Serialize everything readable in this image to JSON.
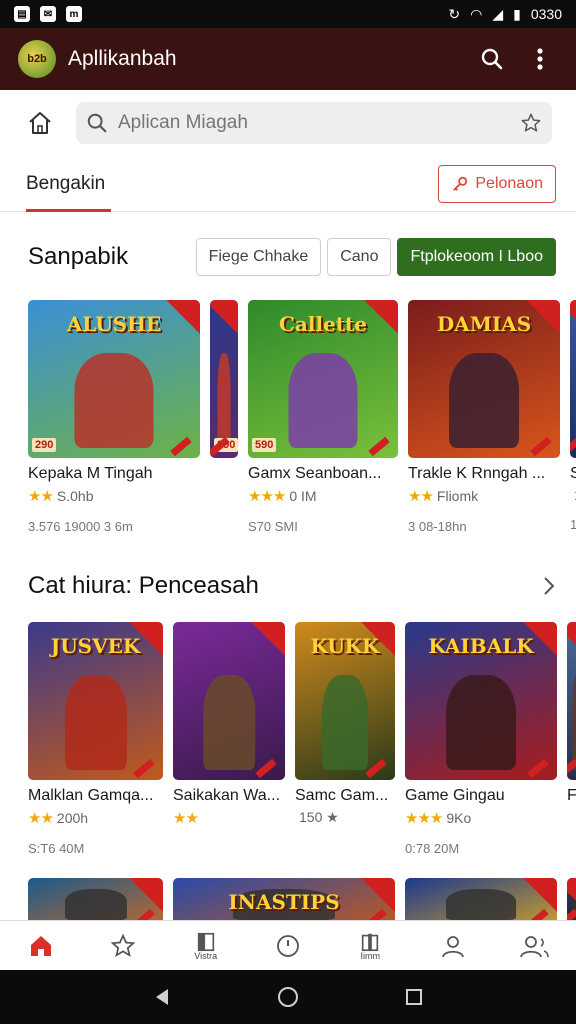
{
  "status_bar": {
    "time": "0330"
  },
  "app_bar": {
    "logo_text": "b2b",
    "title": "Apllikanbah"
  },
  "search": {
    "placeholder": "Aplican Miagah"
  },
  "tabs": {
    "active_label": "Bengakin",
    "action_label": "Pelonaon"
  },
  "section1": {
    "title": "Sanpabik",
    "chips": [
      "Fiege Chhake",
      "Cano",
      "Ftplokeoom I Lboo"
    ],
    "cards": [
      {
        "title": "Kepaka M Tingah",
        "art": "ALUSHE",
        "price": "290",
        "stars": "★★",
        "rating": "S.0hb",
        "meta": "3.576 19000 3 6m",
        "c1": "#3b8fd6",
        "c2": "#6db246",
        "fig": "#b8322a"
      },
      {
        "title": "",
        "art": "",
        "price": "290",
        "stars": "",
        "rating": "",
        "meta": "",
        "c1": "#2a3a8c",
        "c2": "#5a2a6c",
        "fig": "#c23a2a"
      },
      {
        "title": "Gamx Seanboan...",
        "art": "Callette",
        "price": "590",
        "stars": "★★★",
        "rating": "0 IM",
        "meta": "S70 SMI",
        "c1": "#2f8a2c",
        "c2": "#7ac03a",
        "fig": "#7b3ea8"
      },
      {
        "title": "Trakle K Rnngah ...",
        "art": "DAMIAS",
        "price": "",
        "stars": "★★",
        "rating": "Fliomk",
        "meta": "3 08-18hn",
        "c1": "#7a1c1c",
        "c2": "#d8561c",
        "fig": "#3a2030"
      },
      {
        "title": "S",
        "art": "",
        "price": "",
        "stars": "",
        "rating": "1",
        "meta": "1",
        "c1": "#3a5a9a",
        "c2": "#1c2a5a",
        "fig": "#8a2a2a"
      }
    ]
  },
  "section2": {
    "title": "Cat hiura: Penceasah",
    "cards": [
      {
        "title": "Malklan Gamqa...",
        "art": "JUSVEK",
        "price": "",
        "stars": "★★",
        "rating": "200h",
        "meta": "S:T6 40M",
        "c1": "#3a3a8c",
        "c2": "#c25a1c",
        "fig": "#b02a1a"
      },
      {
        "title": "Saikakan Wa...",
        "art": "",
        "price": "",
        "stars": "★★",
        "rating": "",
        "meta": "",
        "c1": "#7a2a9a",
        "c2": "#3a1a4a",
        "fig": "#6a4a2a"
      },
      {
        "title": "Samc Gam...",
        "art": "KUKK",
        "price": "",
        "stars": "",
        "rating": "150 ★",
        "meta": "",
        "c1": "#d08a1c",
        "c2": "#2a3a1a",
        "fig": "#3a6a2a"
      },
      {
        "title": "Game Gingau",
        "art": "KAIBALK",
        "price": "",
        "stars": "★★★",
        "rating": "9Ko",
        "meta": "0:78 20M",
        "c1": "#2a3a8c",
        "c2": "#a81c1c",
        "fig": "#3a1a1a"
      },
      {
        "title": "F",
        "art": "",
        "price": "",
        "stars": "",
        "rating": "",
        "meta": "",
        "c1": "#4a6a9a",
        "c2": "#2a2a4a",
        "fig": "#5a3a2a"
      }
    ]
  },
  "section3": {
    "cards": [
      {
        "art": "",
        "c1": "#1c5a8c",
        "c2": "#c26a2a"
      },
      {
        "art": "INASTIPS",
        "c1": "#2a4aa8",
        "c2": "#c25a1c"
      },
      {
        "art": "",
        "c1": "#1c3a8c",
        "c2": "#d0a02a"
      },
      {
        "art": "",
        "c1": "#3a3a5a",
        "c2": "#1a1a2a"
      }
    ]
  },
  "bottom_nav": {
    "item3_label": "Vistra",
    "item5_label": "Iimm"
  }
}
